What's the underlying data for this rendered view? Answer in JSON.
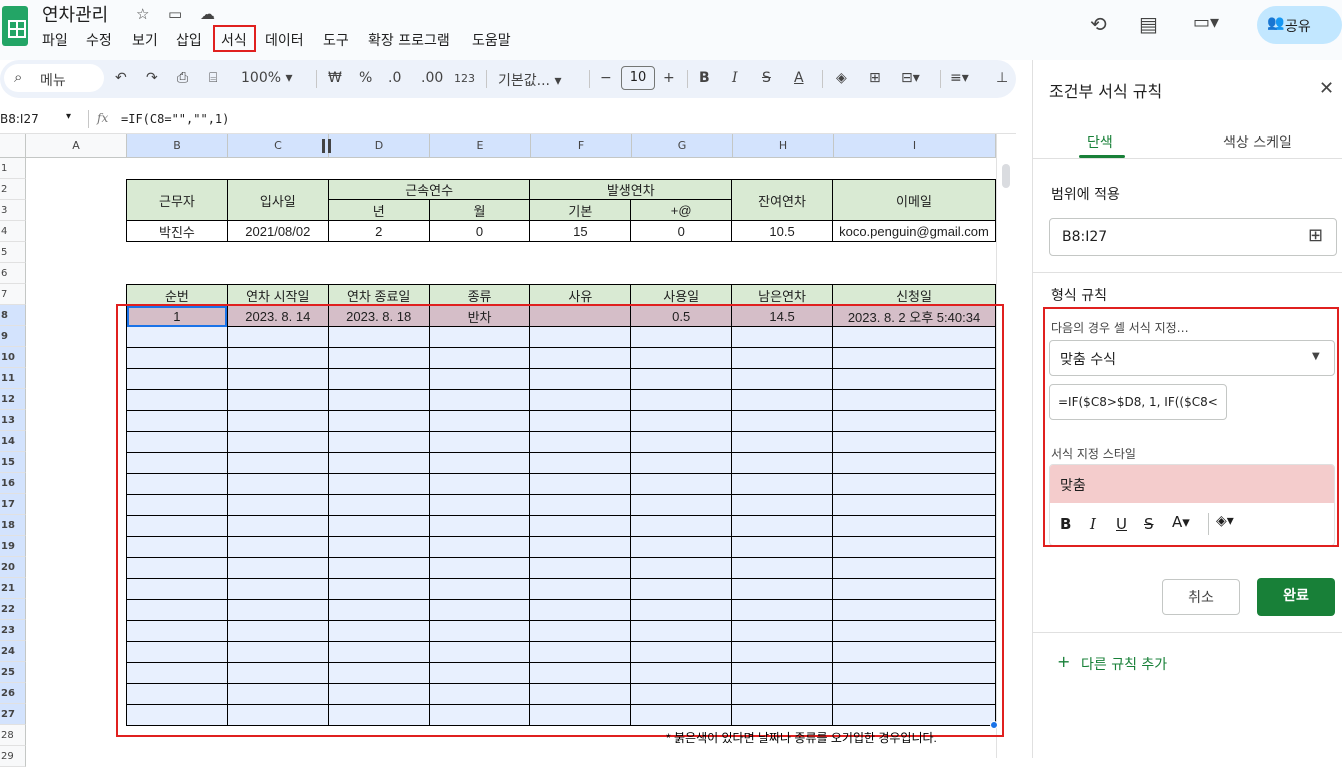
{
  "app": {
    "doc_title": "연차관리"
  },
  "menu": [
    "파일",
    "수정",
    "보기",
    "삽입",
    "서식",
    "데이터",
    "도구",
    "확장 프로그램",
    "도움말"
  ],
  "share_label": "공유",
  "toolbar": {
    "search": "메뉴",
    "zoom": "100%",
    "currency": "₩",
    "percent": "%",
    "dec_dec": ".0",
    "dec_inc": ".00",
    "numfmt": "123",
    "font": "기본값...",
    "font_size": "10"
  },
  "formula_bar": {
    "name_box": "B8:I27",
    "fx": "fx",
    "formula": "=IF(C8=\"\",\"\",1)"
  },
  "columns": [
    "A",
    "B",
    "C",
    "D",
    "E",
    "F",
    "G",
    "H",
    "I"
  ],
  "rows": [
    "1",
    "2",
    "3",
    "4",
    "5",
    "6",
    "7",
    "8",
    "9",
    "10",
    "11",
    "12",
    "13",
    "14",
    "15",
    "16",
    "17",
    "18",
    "19",
    "20",
    "21",
    "22",
    "23",
    "24",
    "25",
    "26",
    "27",
    "28",
    "29"
  ],
  "info_table": {
    "h_worker": "근무자",
    "h_join": "입사일",
    "h_tenure": "근속연수",
    "h_occur": "발생연차",
    "h_remain": "잔여연차",
    "h_email": "이메일",
    "h_year": "년",
    "h_month": "월",
    "h_basic": "기본",
    "h_plus": "+@",
    "worker": "박진수",
    "join": "2021/08/02",
    "year": "2",
    "month": "0",
    "basic": "15",
    "plus": "0",
    "remain": "10.5",
    "email": "koco.penguin@gmail.com"
  },
  "leave_table": {
    "headers": [
      "순번",
      "연차 시작일",
      "연차 종료일",
      "종류",
      "사유",
      "사용일",
      "남은연차",
      "신청일"
    ],
    "row1": [
      "1",
      "2023. 8. 14",
      "2023. 8. 18",
      "반차",
      "",
      "0.5",
      "14.5",
      "2023. 8. 2 오후 5:40:34"
    ]
  },
  "footnote": "* 붉은색이 있다면 날짜나 종류를 오기입한 경우입니다.",
  "panel": {
    "title": "조건부 서식 규칙",
    "tab_single": "단색",
    "tab_scale": "색상 스케일",
    "range_label": "범위에 적용",
    "range_value": "B8:I27",
    "rules_label": "형식 규칙",
    "condition_label": "다음의 경우 셀 서식 지정…",
    "condition_value": "맞춤 수식",
    "formula_value": "=IF($C8>$D8, 1,  IF(($C8<",
    "style_label": "서식 지정 스타일",
    "style_preview": "맞춤",
    "cancel": "취소",
    "done": "완료",
    "add_rule": "다른 규칙 추가"
  },
  "colors": {
    "accent_green": "#188038",
    "header_green": "#d9ead3",
    "highlight_pink": "#d5bec8",
    "selection_blue": "#e8f0fe",
    "annotation_red": "#e0201f"
  }
}
